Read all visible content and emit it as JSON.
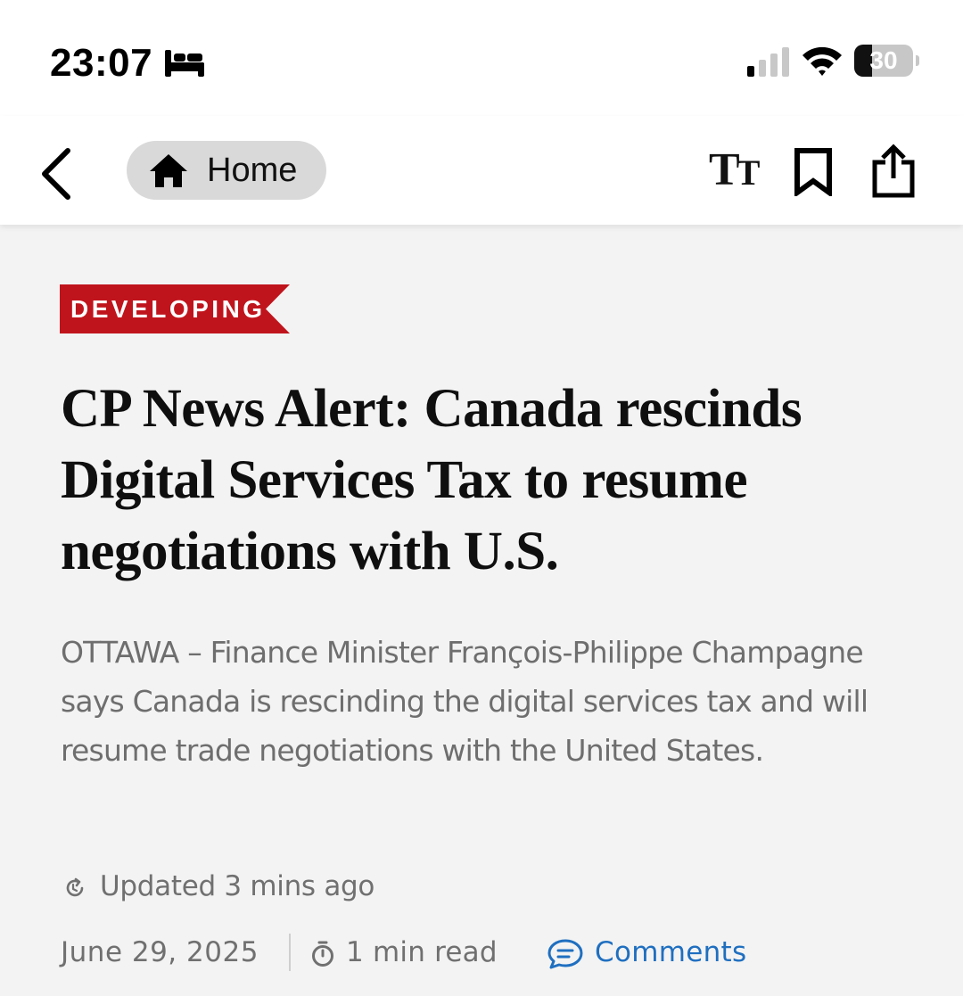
{
  "status_bar": {
    "time": "23:07",
    "focus_icon": "bed-icon",
    "signal_icon": "cellular-signal-icon",
    "wifi_icon": "wifi-icon",
    "battery_level": "30",
    "battery_fraction": 0.3
  },
  "nav": {
    "back_icon": "chevron-left-icon",
    "home_icon": "house-icon",
    "home_label": "Home",
    "text_size_big": "T",
    "text_size_small": "T",
    "bookmark_icon": "bookmark-icon",
    "share_icon": "share-icon"
  },
  "article": {
    "badge": "DEVELOPING",
    "badge_color": "#c0141c",
    "headline": "CP News Alert: Canada rescinds Digital Services Tax to resume negotiations with U.S.",
    "dek": "OTTAWA – Finance Minister François-Philippe Champagne says Canada is rescinding the digital services tax and will resume trade negotiations with the United States.",
    "updated": "Updated 3 mins ago",
    "date": "June 29, 2025",
    "read_time": "1 min read",
    "comments_label": "Comments",
    "link_color": "#1f6fc0"
  }
}
